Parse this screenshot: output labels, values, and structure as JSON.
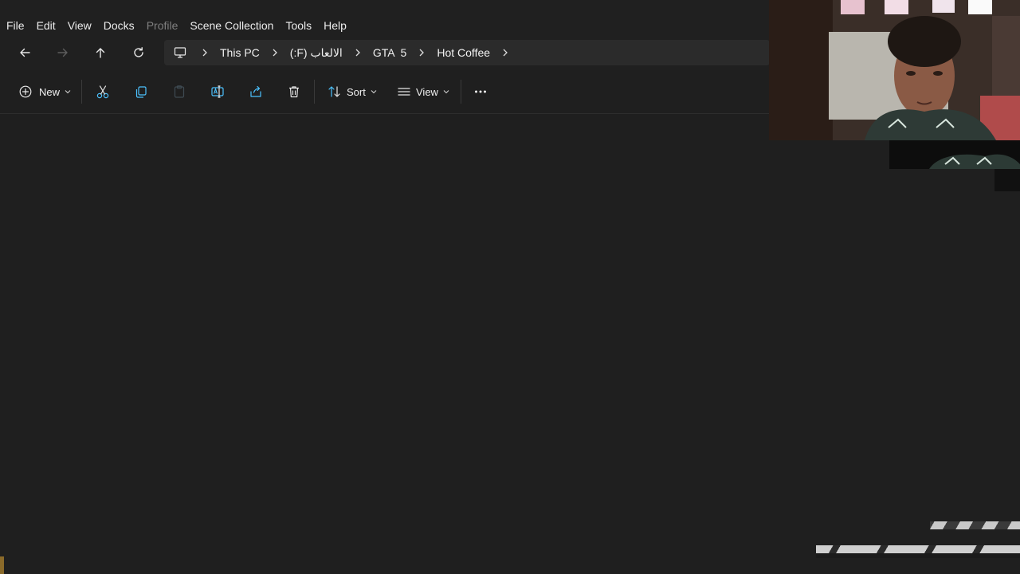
{
  "menubar": {
    "items": [
      {
        "label": "File",
        "disabled": false
      },
      {
        "label": "Edit",
        "disabled": false
      },
      {
        "label": "View",
        "disabled": false
      },
      {
        "label": "Docks",
        "disabled": false
      },
      {
        "label": "Profile",
        "disabled": true
      },
      {
        "label": "Scene Collection",
        "disabled": false
      },
      {
        "label": "Tools",
        "disabled": false
      },
      {
        "label": "Help",
        "disabled": false
      }
    ]
  },
  "nav": {
    "back_icon": "arrow-left-icon",
    "forward_icon": "arrow-right-icon",
    "up_icon": "arrow-up-icon",
    "refresh_icon": "refresh-icon"
  },
  "breadcrumb": {
    "root_icon": "monitor-icon",
    "items": [
      "This PC",
      "الالعاب (F:)",
      "GTA  5",
      "Hot Coffee"
    ]
  },
  "commandbar": {
    "new_label": "New",
    "sort_label": "Sort",
    "view_label": "View",
    "icons": [
      "plus-circle-icon",
      "cut-icon",
      "copy-icon",
      "paste-icon",
      "rename-icon",
      "share-icon",
      "delete-icon",
      "sort-icon",
      "view-lines-icon",
      "more-icon"
    ]
  },
  "colors": {
    "background": "#1f1f1f",
    "toolbar": "#202020",
    "breadcrumb_bg": "#2b2b2b",
    "accent_blue": "#4cc2ff"
  }
}
